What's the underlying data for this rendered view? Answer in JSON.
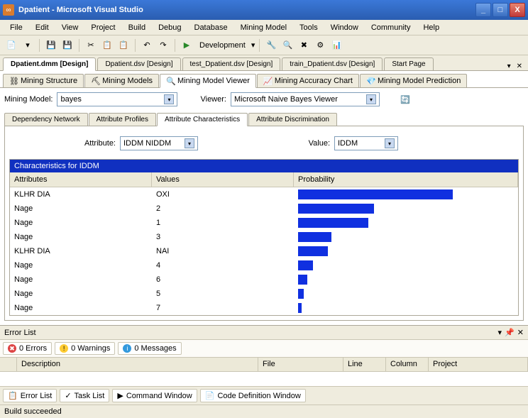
{
  "title": "Dpatient - Microsoft Visual Studio",
  "menu": [
    "File",
    "Edit",
    "View",
    "Project",
    "Build",
    "Debug",
    "Database",
    "Mining Model",
    "Tools",
    "Window",
    "Community",
    "Help"
  ],
  "config": "Development",
  "doctabs": [
    {
      "label": "Dpatient.dmm [Design]",
      "active": true
    },
    {
      "label": "Dpatient.dsv [Design]",
      "active": false
    },
    {
      "label": "test_Dpatient.dsv [Design]",
      "active": false
    },
    {
      "label": "train_Dpatient.dsv [Design]",
      "active": false
    },
    {
      "label": "Start Page",
      "active": false
    }
  ],
  "subtabs": [
    {
      "label": "Mining Structure",
      "active": false
    },
    {
      "label": "Mining Models",
      "active": false
    },
    {
      "label": "Mining Model Viewer",
      "active": true
    },
    {
      "label": "Mining Accuracy Chart",
      "active": false
    },
    {
      "label": "Mining Model Prediction",
      "active": false
    }
  ],
  "miningModelLabel": "Mining Model:",
  "miningModel": "bayes",
  "viewerLabel": "Viewer:",
  "viewer": "Microsoft Naive Bayes Viewer",
  "innerTabs": [
    {
      "label": "Dependency Network",
      "active": false
    },
    {
      "label": "Attribute Profiles",
      "active": false
    },
    {
      "label": "Attribute Characteristics",
      "active": true
    },
    {
      "label": "Attribute Discrimination",
      "active": false
    }
  ],
  "attributeLabel": "Attribute:",
  "attribute": "IDDM NIDDM",
  "valueLabel": "Value:",
  "value": "IDDM",
  "gridTitle": "Characteristics for IDDM",
  "headers": {
    "a": "Attributes",
    "v": "Values",
    "p": "Probability"
  },
  "rows": [
    {
      "a": "KLHR DIA",
      "v": "OXI",
      "p": 84
    },
    {
      "a": "Nage",
      "v": "2",
      "p": 41
    },
    {
      "a": "Nage",
      "v": "1",
      "p": 38
    },
    {
      "a": "Nage",
      "v": "3",
      "p": 18
    },
    {
      "a": "KLHR DIA",
      "v": "NAI",
      "p": 16
    },
    {
      "a": "Nage",
      "v": "4",
      "p": 8
    },
    {
      "a": "Nage",
      "v": "6",
      "p": 5
    },
    {
      "a": "Nage",
      "v": "5",
      "p": 3
    },
    {
      "a": "Nage",
      "v": "7",
      "p": 2
    }
  ],
  "errorList": {
    "title": "Error List",
    "errors": "0 Errors",
    "warnings": "0 Warnings",
    "messages": "0 Messages",
    "cols": [
      "",
      "Description",
      "File",
      "Line",
      "Column",
      "Project"
    ]
  },
  "bottomTabs": [
    "Error List",
    "Task List",
    "Command Window",
    "Code Definition Window"
  ],
  "status": "Build succeeded",
  "chart_data": {
    "type": "bar",
    "title": "Characteristics for IDDM",
    "xlabel": "Probability",
    "ylabel": "Attribute / Value",
    "categories": [
      "KLHR DIA=OXI",
      "Nage=2",
      "Nage=1",
      "Nage=3",
      "KLHR DIA=NAI",
      "Nage=4",
      "Nage=6",
      "Nage=5",
      "Nage=7"
    ],
    "values": [
      84,
      41,
      38,
      18,
      16,
      8,
      5,
      3,
      2
    ],
    "xlim": [
      0,
      100
    ]
  }
}
